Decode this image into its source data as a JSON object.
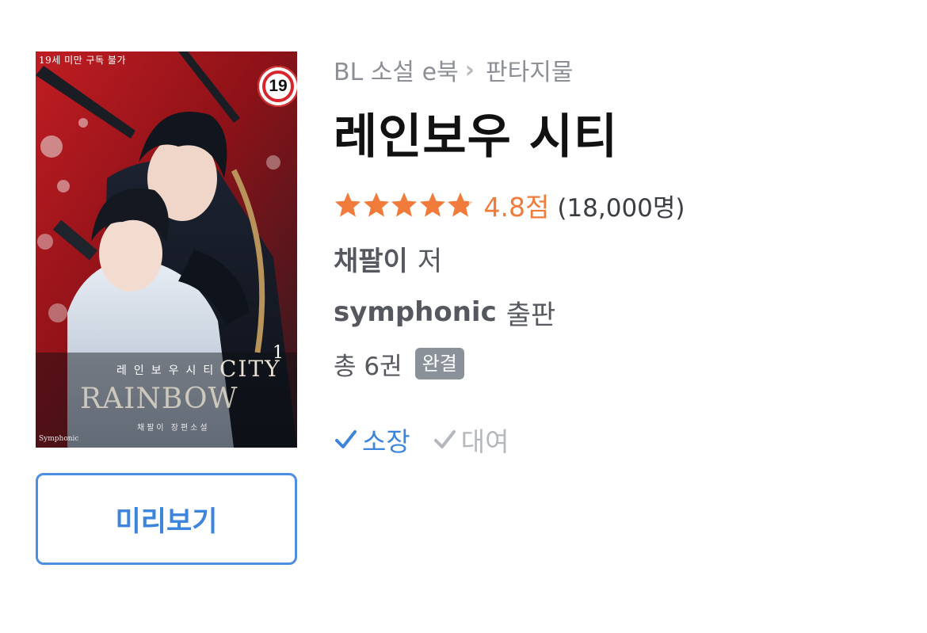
{
  "cover": {
    "age_notice": "19세 미만 구독 불가",
    "age_badge": "19",
    "author_tag": "채팔이",
    "korean_title": "레인보우시티",
    "volume": "1",
    "city_text": "CITY",
    "rainbow_text": "RAINBOW",
    "author_line": "채팔이 장편소설",
    "publisher_mark": "Symphonic"
  },
  "preview_button": {
    "label": "미리보기"
  },
  "breadcrumb": {
    "category": "BL 소설 e북",
    "subcategory": "판타지물"
  },
  "title": "레인보우 시티",
  "rating": {
    "stars": 4.8,
    "max_stars": 5,
    "score_label": "4.8점",
    "count_label": "(18,000명)",
    "star_color": "#f07b3a"
  },
  "author": {
    "name": "채팔이",
    "suffix": "저"
  },
  "publisher": {
    "name": "symphonic",
    "suffix": "출판"
  },
  "volumes": {
    "label": "총 6권",
    "status": "완결"
  },
  "purchase_options": [
    {
      "label": "소장",
      "active": true
    },
    {
      "label": "대여",
      "active": false
    }
  ],
  "colors": {
    "accent_blue": "#3c84dc",
    "rating_orange": "#f07b3a",
    "badge_gray": "#8a9199"
  }
}
